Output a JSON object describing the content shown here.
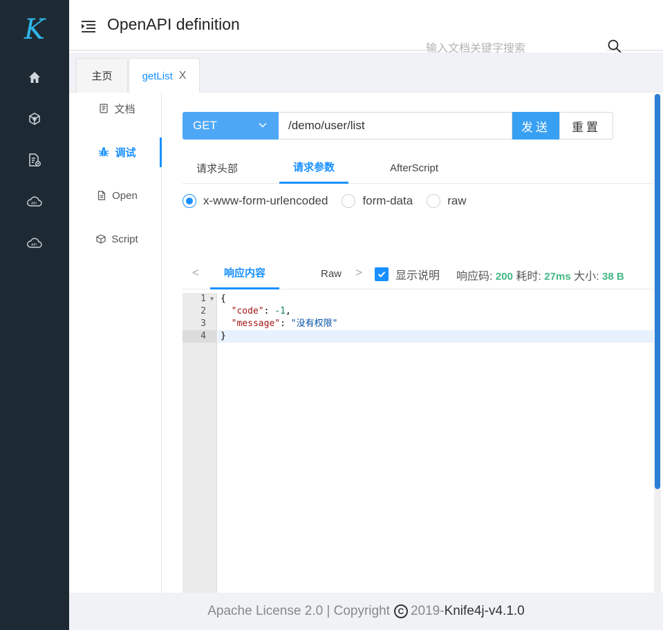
{
  "app": {
    "logo_letter": "K",
    "title": "OpenAPI definition"
  },
  "sidebar": {
    "icons": [
      "home-icon",
      "api-cube-icon",
      "doc-settings-icon",
      "api-cloud-icon",
      "api-cloud-icon-2"
    ]
  },
  "search": {
    "placeholder": "输入文档关键字搜索",
    "value": ""
  },
  "page_tabs": [
    {
      "label": "主页",
      "active": false
    },
    {
      "label": "getList",
      "active": true,
      "close": "X"
    }
  ],
  "sub_nav": [
    {
      "label": "文档",
      "icon": "document-icon",
      "active": false
    },
    {
      "label": "调试",
      "icon": "bug-icon",
      "active": true
    },
    {
      "label": "Open",
      "icon": "file-icon",
      "active": false
    },
    {
      "label": "Script",
      "icon": "code-cube-icon",
      "active": false
    }
  ],
  "request": {
    "method": "GET",
    "url": "/demo/user/list",
    "send_label": "发送",
    "reset_label": "重置"
  },
  "request_tabs": [
    {
      "label": "请求头部",
      "active": false
    },
    {
      "label": "请求参数",
      "active": true
    },
    {
      "label": "AfterScript",
      "active": false
    }
  ],
  "body_types": [
    {
      "label": "x-www-form-urlencoded",
      "checked": true
    },
    {
      "label": "form-data",
      "checked": false
    },
    {
      "label": "raw",
      "checked": false
    }
  ],
  "response": {
    "prev_arrow": "<",
    "next_arrow": ">",
    "tabs": [
      {
        "label": "响应内容",
        "active": true
      },
      {
        "label": "Raw",
        "active": false
      }
    ],
    "show_desc_label": "显示说明",
    "show_desc_checked": true,
    "status_label": "响应码:",
    "status_value": "200",
    "time_label": "耗时:",
    "time_value": "27ms",
    "size_label": "大小:",
    "size_value": "38 B"
  },
  "code": {
    "line_numbers": [
      "1",
      "2",
      "3",
      "4"
    ],
    "lines": {
      "l1": "{",
      "l2_key": "\"code\"",
      "l2_sep": ": ",
      "l2_val": "-1",
      "l2_end": ",",
      "l3_key": "\"message\"",
      "l3_sep": ": ",
      "l3_val": "\"没有权限\"",
      "l4": "}"
    }
  },
  "footer": {
    "license": "Apache License 2.0 | Copyright",
    "copyright_symbol": "C",
    "year_prefix": "2019-",
    "version": "Knife4j-v4.1.0"
  },
  "colors": {
    "sidebar_bg": "#1e2a33",
    "accent": "#1890ff",
    "method_bg": "#4ea7f5",
    "send_bg": "#38a0f3",
    "stat_green": "#41b883"
  }
}
